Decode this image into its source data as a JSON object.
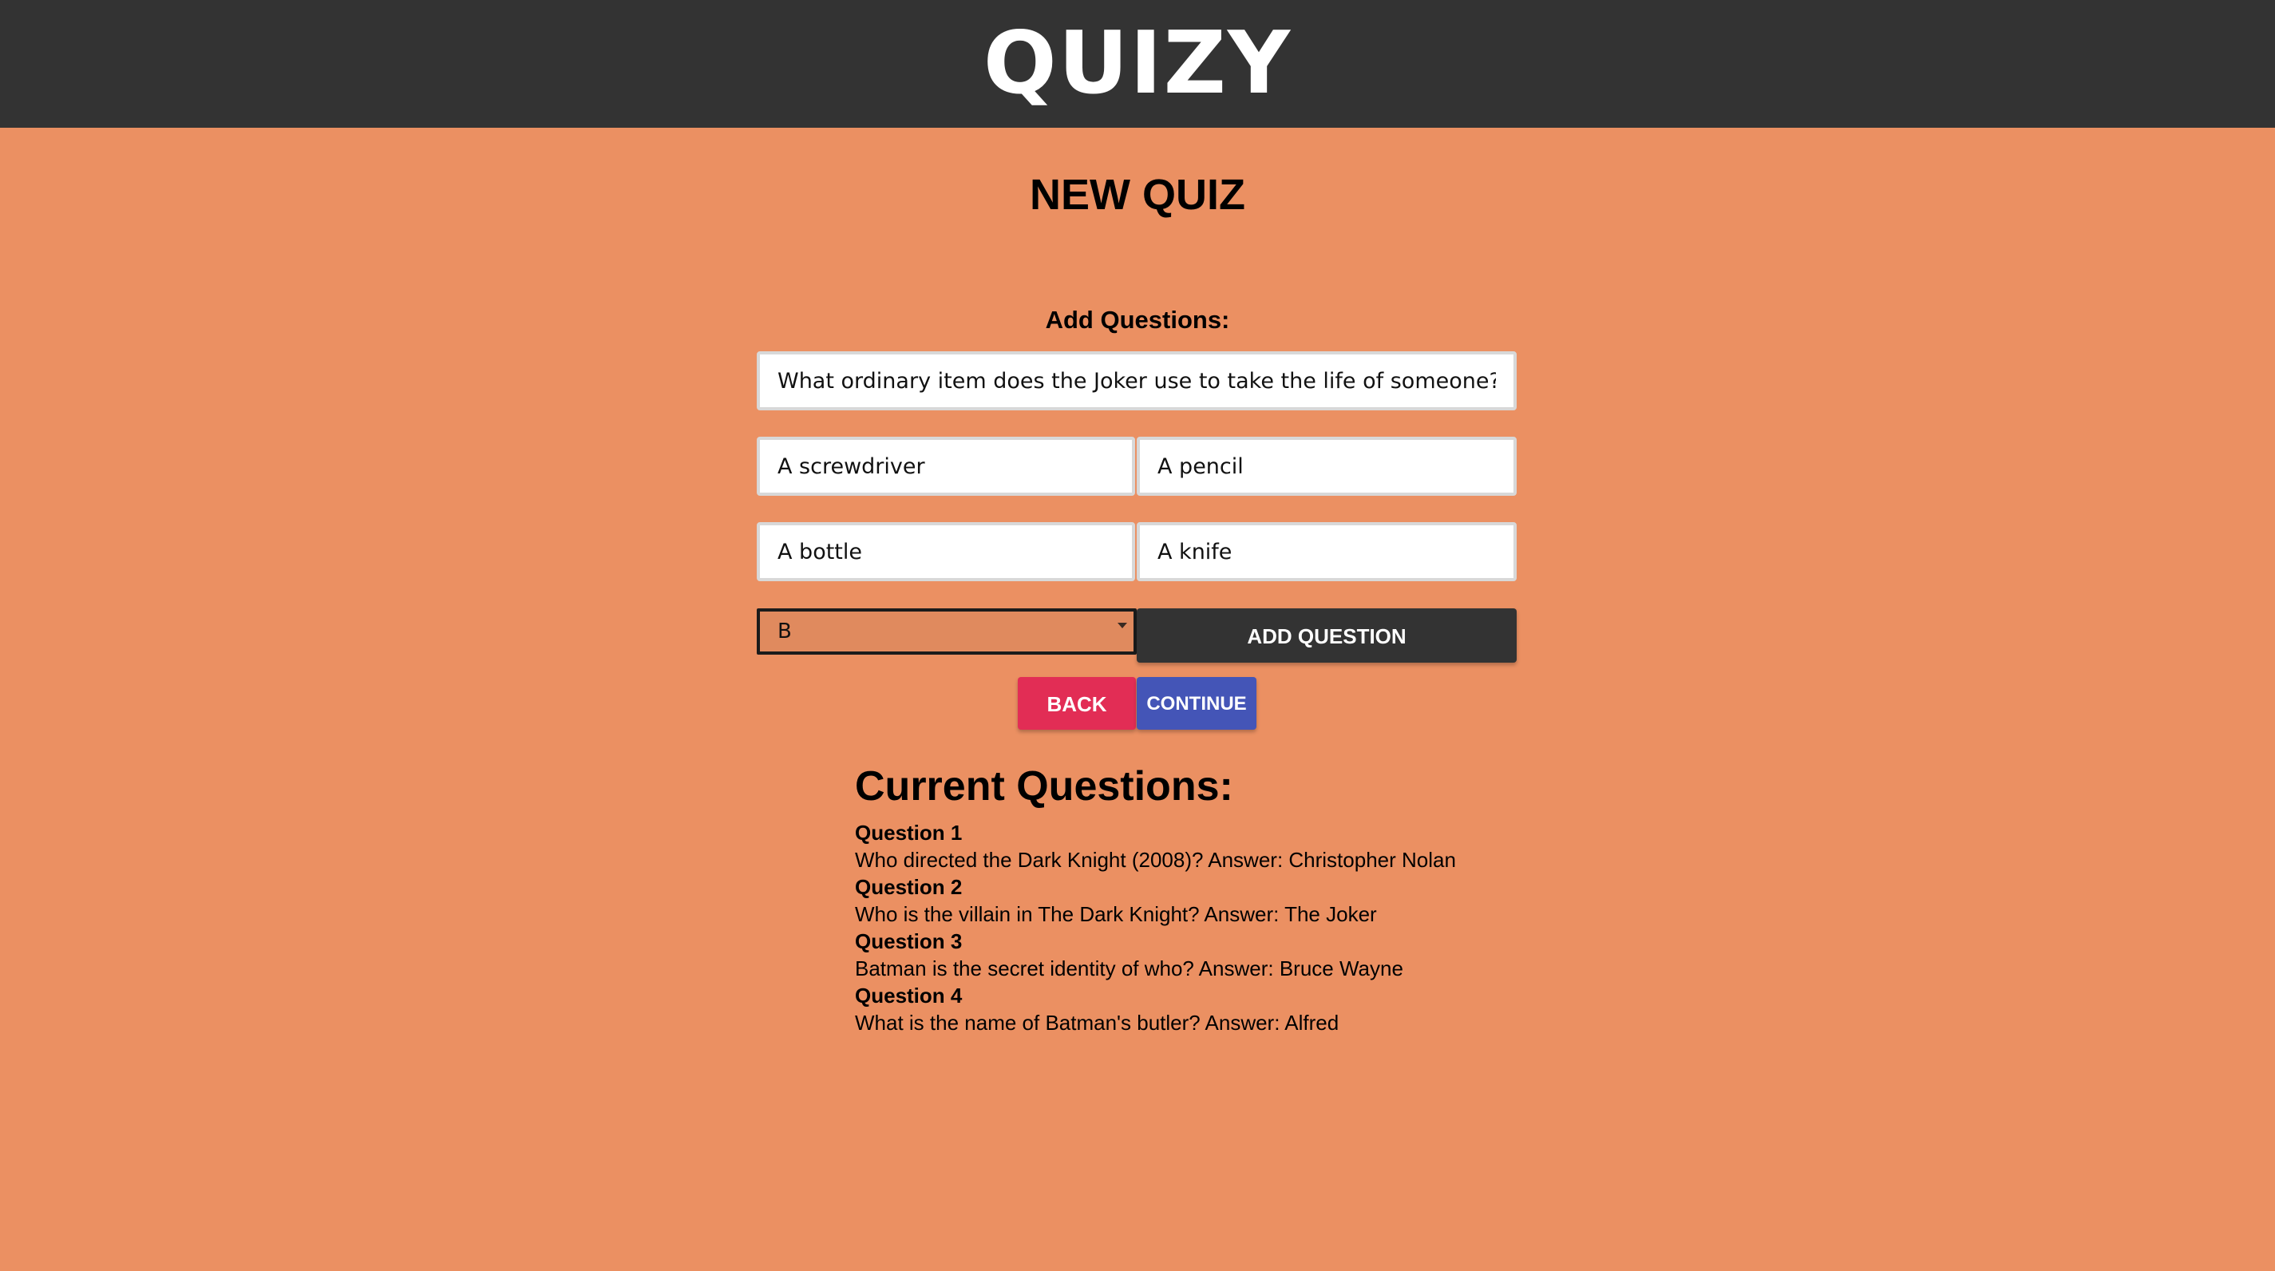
{
  "app": {
    "brand": "QUIZY"
  },
  "page": {
    "title": "NEW QUIZ",
    "section_label": "Add Questions:"
  },
  "form": {
    "question_value": "What ordinary item does the Joker use to take the life of someone?",
    "answers": [
      "A screwdriver",
      "A pencil",
      "A bottle",
      "A knife"
    ],
    "correct_answer_selected": "B",
    "add_button_label": "ADD QUESTION",
    "back_button_label": "BACK",
    "continue_button_label": "CONTINUE"
  },
  "current": {
    "title": "Current Questions:",
    "questions": [
      {
        "heading": "Question 1",
        "text": "Who directed the Dark Knight (2008)? Answer: Christopher Nolan"
      },
      {
        "heading": "Question 2",
        "text": "Who is the villain in The Dark Knight? Answer: The Joker"
      },
      {
        "heading": "Question 3",
        "text": "Batman is the secret identity of who? Answer: Bruce Wayne"
      },
      {
        "heading": "Question 4",
        "text": "What is the name of Batman's butler? Answer: Alfred"
      }
    ]
  },
  "colors": {
    "background": "#EB9062",
    "topbar": "#333333",
    "back_button": "#E22D55",
    "continue_button": "#4455B7",
    "add_button": "#333333"
  },
  "icons": {
    "select_caret": "caret-down-icon"
  }
}
